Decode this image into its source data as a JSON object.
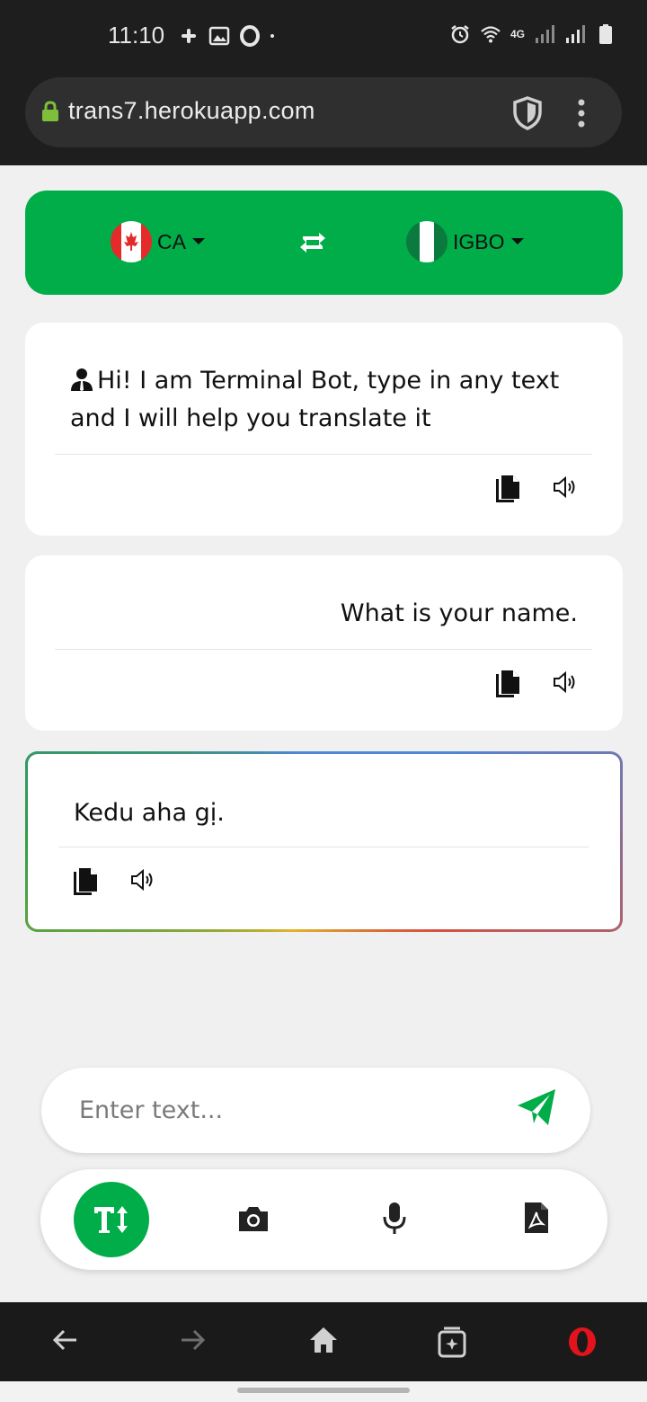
{
  "status_bar": {
    "time": "11:10",
    "left_icons": [
      "slack-icon",
      "image-icon",
      "opera-icon",
      "dot-icon"
    ],
    "right_icons": [
      "alarm-icon",
      "wifi-icon",
      "4g-icon",
      "signal-icon",
      "signal-icon",
      "battery-icon"
    ],
    "network_label": "4G"
  },
  "browser": {
    "url": "trans7.herokuapp.com"
  },
  "language_bar": {
    "source_label": "CA",
    "target_label": "IGBO",
    "accent_color": "#00ad48"
  },
  "messages": [
    {
      "text": "Hi! I am Terminal Bot, type in any text and I will help you translate it",
      "icon": "bot-user-icon"
    },
    {
      "text": "What is your name."
    },
    {
      "text": "Kedu aha gị."
    }
  ],
  "input": {
    "placeholder": "Enter text..."
  },
  "modes": [
    "text-mode-icon",
    "camera-icon",
    "mic-icon",
    "pdf-icon"
  ]
}
